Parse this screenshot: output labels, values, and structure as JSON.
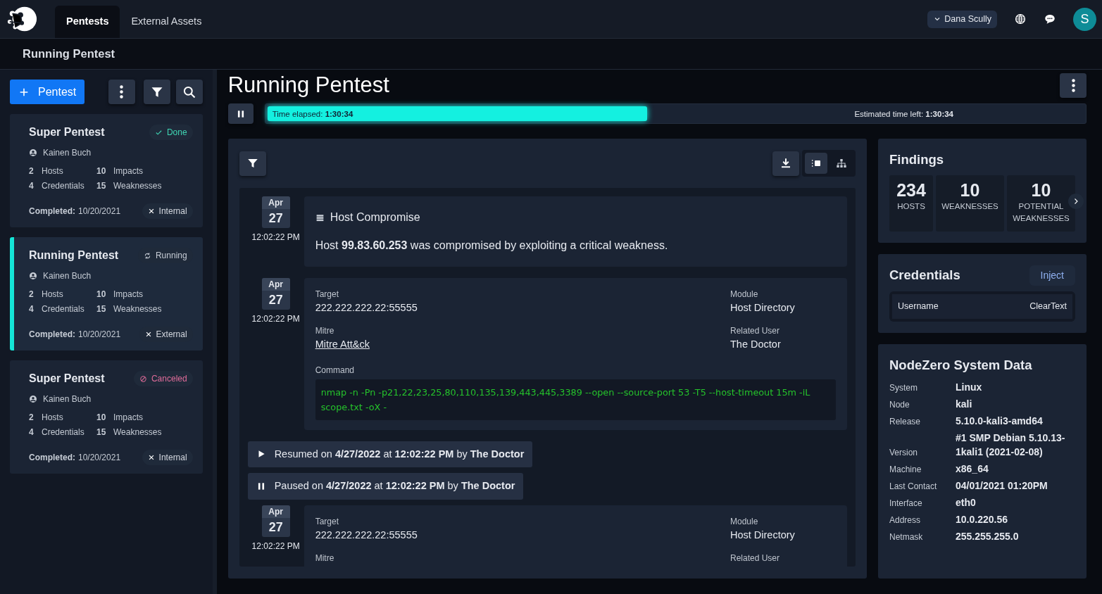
{
  "nav": {
    "tabs": [
      {
        "label": "Pentests",
        "selected": true
      },
      {
        "label": "External Assets",
        "selected": false
      }
    ],
    "user": "Dana Scully",
    "avatar": "S"
  },
  "subheader": {
    "title": "Running Pentest"
  },
  "sidebar": {
    "new_button": "Pentest",
    "pentests": [
      {
        "title": "Super Pentest",
        "status": {
          "kind": "done",
          "label": "Done"
        },
        "owner": "Kainen Buch",
        "hosts": "2",
        "hosts_label": "Hosts",
        "credentials": "4",
        "credentials_label": "Credentials",
        "impacts": "10",
        "impacts_label": "Impacts",
        "weaknesses": "15",
        "weaknesses_label": "Weaknesses",
        "completed_label": "Completed:",
        "completed": "10/20/2021",
        "scope": "Internal",
        "selected": false
      },
      {
        "title": "Running Pentest",
        "status": {
          "kind": "running",
          "label": "Running"
        },
        "owner": "Kainen Buch",
        "hosts": "2",
        "hosts_label": "Hosts",
        "credentials": "4",
        "credentials_label": "Credentials",
        "impacts": "10",
        "impacts_label": "Impacts",
        "weaknesses": "15",
        "weaknesses_label": "Weaknesses",
        "completed_label": "Completed:",
        "completed": "10/20/2021",
        "scope": "External",
        "selected": true
      },
      {
        "title": "Super Pentest",
        "status": {
          "kind": "canceled",
          "label": "Canceled"
        },
        "owner": "Kainen Buch",
        "hosts": "2",
        "hosts_label": "Hosts",
        "credentials": "4",
        "credentials_label": "Credentials",
        "impacts": "10",
        "impacts_label": "Impacts",
        "weaknesses": "15",
        "weaknesses_label": "Weaknesses",
        "completed_label": "Completed:",
        "completed": "10/20/2021",
        "scope": "Internal",
        "selected": false
      }
    ]
  },
  "main": {
    "title": "Running Pentest",
    "progress": {
      "elapsed": "Time elapsed: **1:30:34**",
      "left": "Estimated time left: **1:30:34**",
      "level": 0.465
    },
    "view_toggle": [
      {
        "kind": "list",
        "selected": true
      },
      {
        "kind": "tree",
        "selected": false
      }
    ],
    "timeline": [
      {
        "kind": "finding",
        "month": "Apr",
        "day": "27",
        "time": "12:02:22 PM",
        "title": "Host Compromise",
        "text": "Host **99.83.60.253** was compromised by exploiting a critical weakness."
      },
      {
        "kind": "detail",
        "month": "Apr",
        "day": "27",
        "time": "12:02:22 PM",
        "fields": [
          {
            "label": "Target",
            "value": "222.222.222.22:55555"
          },
          {
            "label": "Module",
            "value": "Host Directory"
          },
          {
            "label": "Mitre",
            "value": "Mitre Att&ck",
            "link": true
          },
          {
            "label": "Related User",
            "value": "The Doctor"
          }
        ],
        "command_label": "Command",
        "command": "nmap -n -Pn -p21,22,23,25,80,110,135,139,443,445,3389 --open --source-port 53 -T5 --host-timeout 15m -iL scope.txt -oX -"
      },
      {
        "kind": "resumed",
        "text": "Resumed on **4/27/2022** at **12:02:22 PM** by **The Doctor**"
      },
      {
        "kind": "paused",
        "text": "Paused on **4/27/2022** at **12:02:22 PM** by **The Doctor**"
      },
      {
        "kind": "detail",
        "month": "Apr",
        "day": "27",
        "time": "12:02:22 PM",
        "fields": [
          {
            "label": "Target",
            "value": "222.222.222.22:55555"
          },
          {
            "label": "Module",
            "value": "Host Directory"
          },
          {
            "label": "Mitre"
          },
          {
            "label": "Related User"
          }
        ]
      }
    ]
  },
  "findings": {
    "title": "Findings",
    "stats": [
      {
        "value": "234",
        "label": "HOSTS"
      },
      {
        "value": "10",
        "label": "WEAKNESSES"
      },
      {
        "value": "10",
        "label": "POTENTIAL WEAKNESSES"
      }
    ]
  },
  "credentials": {
    "title": "Credentials",
    "action": "Inject",
    "columns": [
      "Username",
      "ClearText"
    ]
  },
  "system": {
    "title": "NodeZero System Data",
    "rows": [
      {
        "label": "System",
        "value": "Linux"
      },
      {
        "label": "Node",
        "value": "kali"
      },
      {
        "label": "Release",
        "value": "5.10.0-kali3-amd64"
      },
      {
        "label": "Version",
        "value": "#1 SMP Debian 5.10.13-1kali1 (2021-02-08)"
      },
      {
        "label": "Machine",
        "value": "x86_64"
      },
      {
        "label": "Last Contact",
        "value": "04/01/2021 01:20PM"
      },
      {
        "label": "Interface",
        "value": "eth0"
      },
      {
        "label": "Address",
        "value": "10.0.220.56"
      },
      {
        "label": "Netmask",
        "value": "255.255.255.0"
      }
    ]
  }
}
